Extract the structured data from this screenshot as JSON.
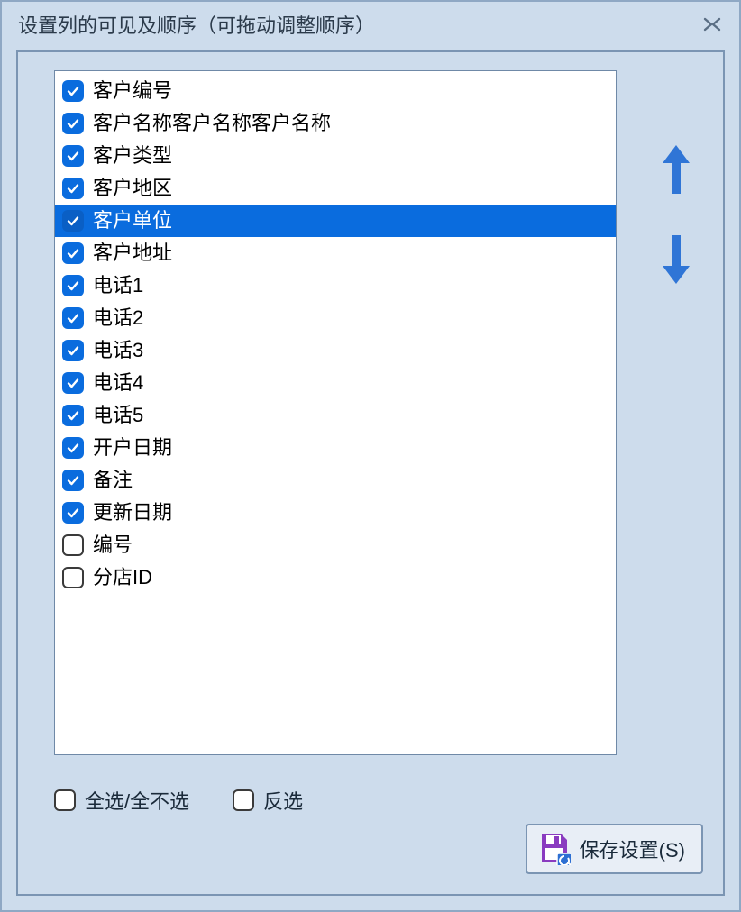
{
  "dialog": {
    "title": "设置列的可见及顺序（可拖动调整顺序）"
  },
  "columns": [
    {
      "label": "客户编号",
      "checked": true,
      "selected": false
    },
    {
      "label": "客户名称客户名称客户名称",
      "checked": true,
      "selected": false
    },
    {
      "label": "客户类型",
      "checked": true,
      "selected": false
    },
    {
      "label": "客户地区",
      "checked": true,
      "selected": false
    },
    {
      "label": "客户单位",
      "checked": true,
      "selected": true
    },
    {
      "label": "客户地址",
      "checked": true,
      "selected": false
    },
    {
      "label": "电话1",
      "checked": true,
      "selected": false
    },
    {
      "label": "电话2",
      "checked": true,
      "selected": false
    },
    {
      "label": "电话3",
      "checked": true,
      "selected": false
    },
    {
      "label": "电话4",
      "checked": true,
      "selected": false
    },
    {
      "label": "电话5",
      "checked": true,
      "selected": false
    },
    {
      "label": "开户日期",
      "checked": true,
      "selected": false
    },
    {
      "label": "备注",
      "checked": true,
      "selected": false
    },
    {
      "label": "更新日期",
      "checked": true,
      "selected": false
    },
    {
      "label": "编号",
      "checked": false,
      "selected": false
    },
    {
      "label": "分店ID",
      "checked": false,
      "selected": false
    }
  ],
  "controls": {
    "selectAll": "全选/全不选",
    "invert": "反选",
    "save": "保存设置(S)"
  }
}
